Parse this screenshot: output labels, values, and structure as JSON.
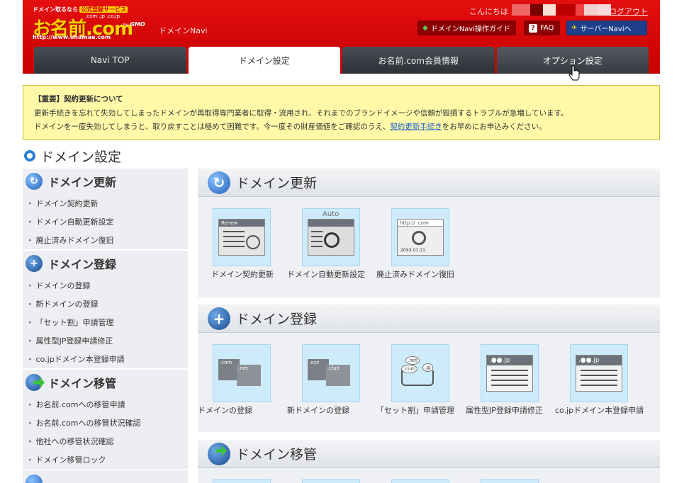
{
  "header": {
    "logo_tagline": "ドメイン取るなら",
    "logo_badge": "公式登録サービス",
    "logo_tlds": ".com .jp .co.jp",
    "logo_brand": "お名前.com",
    "logo_url": "http://www.onamae.com",
    "gmo_by": "by",
    "gmo": "GMO",
    "navi_label": "ドメインNavi",
    "greeting": "こんにちは",
    "logout": "ログアウト",
    "buttons": {
      "guide": "ドメインNavi操作ガイド",
      "faq": "FAQ",
      "faq_icon": "?",
      "server": "サーバーNaviへ"
    }
  },
  "tabs": [
    {
      "label": "Navi TOP"
    },
    {
      "label": "ドメイン設定"
    },
    {
      "label": "お名前.com会員情報"
    },
    {
      "label": "オプション設定"
    }
  ],
  "notice": {
    "title": "【重要】契約更新について",
    "line1": "更新手続きを忘れて失効してしまったドメインが再取得専門業者に取得・流用され、それまでのブランドイメージや信頼が毀損するトラブルが急増しています。",
    "line2_prefix": "ドメインを一度失効してしまうと、取り戻すことは極めて困難です。今一度その財産価値をご確認のうえ、",
    "line2_link": "契約更新手続き",
    "line2_suffix": "をお早めにお申込みください。"
  },
  "page_title": "ドメイン設定",
  "sidebar": {
    "sections": [
      {
        "title": "ドメイン更新",
        "items": [
          "ドメイン契約更新",
          "ドメイン自動更新設定",
          "廃止済みドメイン復旧"
        ]
      },
      {
        "title": "ドメイン登録",
        "items": [
          "ドメインの登録",
          "新ドメインの登録",
          "「セット割」申請管理",
          "属性型JP登録申請修正",
          "co.jpドメイン本登録申請"
        ]
      },
      {
        "title": "ドメイン移管",
        "items": [
          "お名前.comへの移管申請",
          "お名前.comへの移管状況確認",
          "他社への移管状況確認",
          "ドメイン移管ロック"
        ]
      }
    ]
  },
  "panels": {
    "renew": {
      "title": "ドメイン更新",
      "tiles": [
        {
          "label": "ドメイン契約更新",
          "thumb_text": "Renew"
        },
        {
          "label": "ドメイン自動更新設定",
          "thumb_text": "Auto"
        },
        {
          "label": "廃止済みドメイン復旧",
          "thumb_text": "http://   .com",
          "thumb_date": "20XX.01.11"
        }
      ]
    },
    "register": {
      "title": "ドメイン登録",
      "tiles": [
        {
          "label": "ドメインの登録",
          "thumb_a": ".com",
          "thumb_b": ".net"
        },
        {
          "label": "新ドメインの登録",
          "thumb_a": ".xyz",
          "thumb_b": ".club"
        },
        {
          "label": "「セット割」申請管理",
          "thumb_a": ".net",
          "thumb_b": ".com",
          "thumb_c": ".jp"
        },
        {
          "label": "属性型JP登録申請修正",
          "thumb_a": ".●●.jp"
        },
        {
          "label": "co.jpドメイン本登録申請",
          "thumb_a": ".●●.jp"
        }
      ]
    },
    "transfer": {
      "title": "ドメイン移管"
    }
  },
  "colors": {
    "header_red": "#d40606",
    "accent_blue": "#2a7fd4",
    "notice_bg": "#fff9a8",
    "tile_bg": "#cdebfb"
  }
}
